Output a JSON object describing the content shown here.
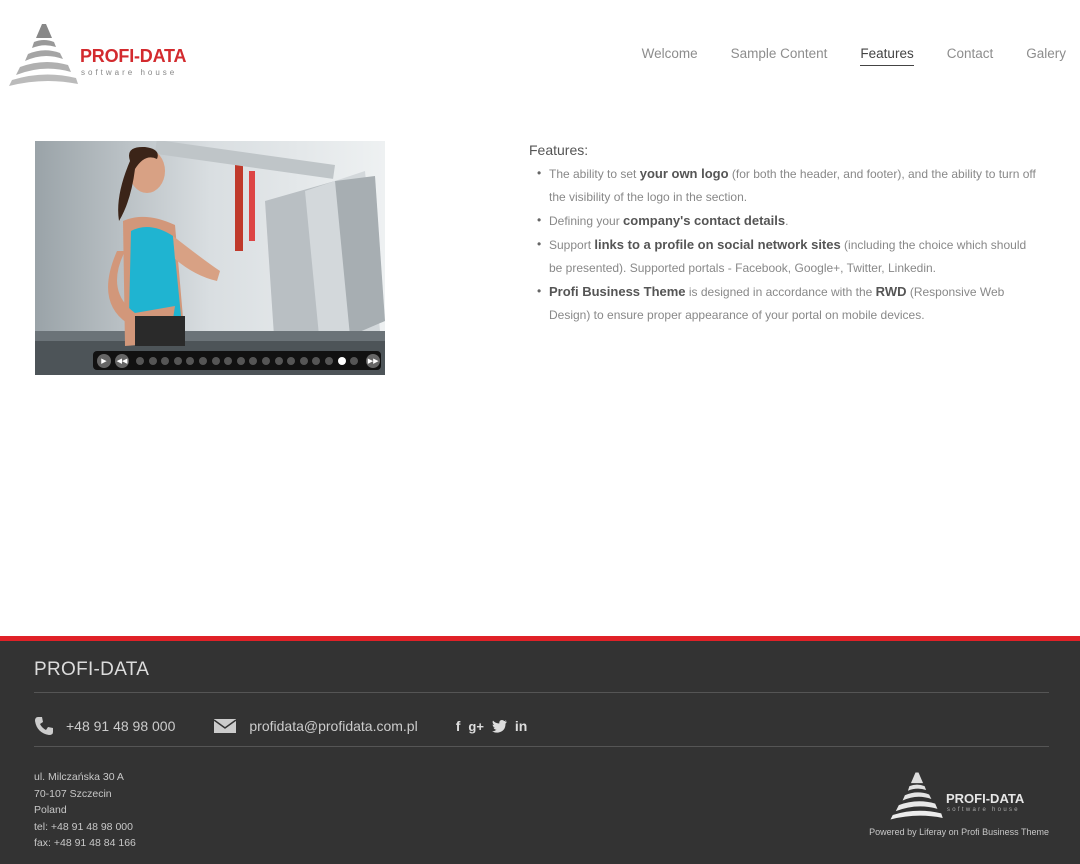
{
  "brand": {
    "logo_title": "PROFI-DATA",
    "logo_subtitle": "software house",
    "accent_color": "#d32a2e"
  },
  "nav": {
    "items": [
      {
        "label": "Welcome",
        "active": false
      },
      {
        "label": "Sample Content",
        "active": false
      },
      {
        "label": "Features",
        "active": true
      },
      {
        "label": "Contact",
        "active": false
      },
      {
        "label": "Galery",
        "active": false
      }
    ]
  },
  "slider": {
    "image_subject": "woman running on treadmill",
    "controls": {
      "play_icon": "play-icon",
      "prev_icon": "rewind-icon",
      "next_icon": "fast-forward-icon",
      "slide_count": 17,
      "active_slide": 17
    }
  },
  "features": {
    "heading": "Features:",
    "items": [
      {
        "p1": "The ability to set ",
        "b1": "your own logo",
        "p2": " (for both the header, and footer), and the ability to turn off the visibility of the logo in the section.",
        "b2": "",
        "p3": ""
      },
      {
        "p1": "Defining your ",
        "b1": "company's contact details",
        "p2": ".",
        "b2": "",
        "p3": ""
      },
      {
        "p1": "Support ",
        "b1": "links to a profile on social network sites",
        "p2": " (including the choice which should be presented). Supported portals - Facebook, Google+, Twitter, Linkedin.",
        "b2": "",
        "p3": ""
      },
      {
        "p1": "",
        "b1": "Profi Business Theme",
        "p2": " is designed in accordance with the ",
        "b2": "RWD",
        "p3": " (Responsive Web Design) to ensure proper appearance of your portal on mobile devices."
      }
    ]
  },
  "footer": {
    "title": "PROFI-DATA",
    "phone": "+48 91 48 98 000",
    "email": "profidata@profidata.com.pl",
    "social": [
      "f",
      "g+",
      "twitter",
      "in"
    ],
    "address": {
      "street": "ul. Milczańska 30 A",
      "city": "70-107 Szczecin",
      "country": "Poland",
      "tel": "tel: +48 91 48 98 000",
      "fax": "fax: +48 91 48 84 166"
    },
    "logo_title": "PROFI-DATA",
    "logo_subtitle": "software house",
    "powered": "Powered by Liferay on Profi Business Theme",
    "border_color": "#e02127"
  }
}
